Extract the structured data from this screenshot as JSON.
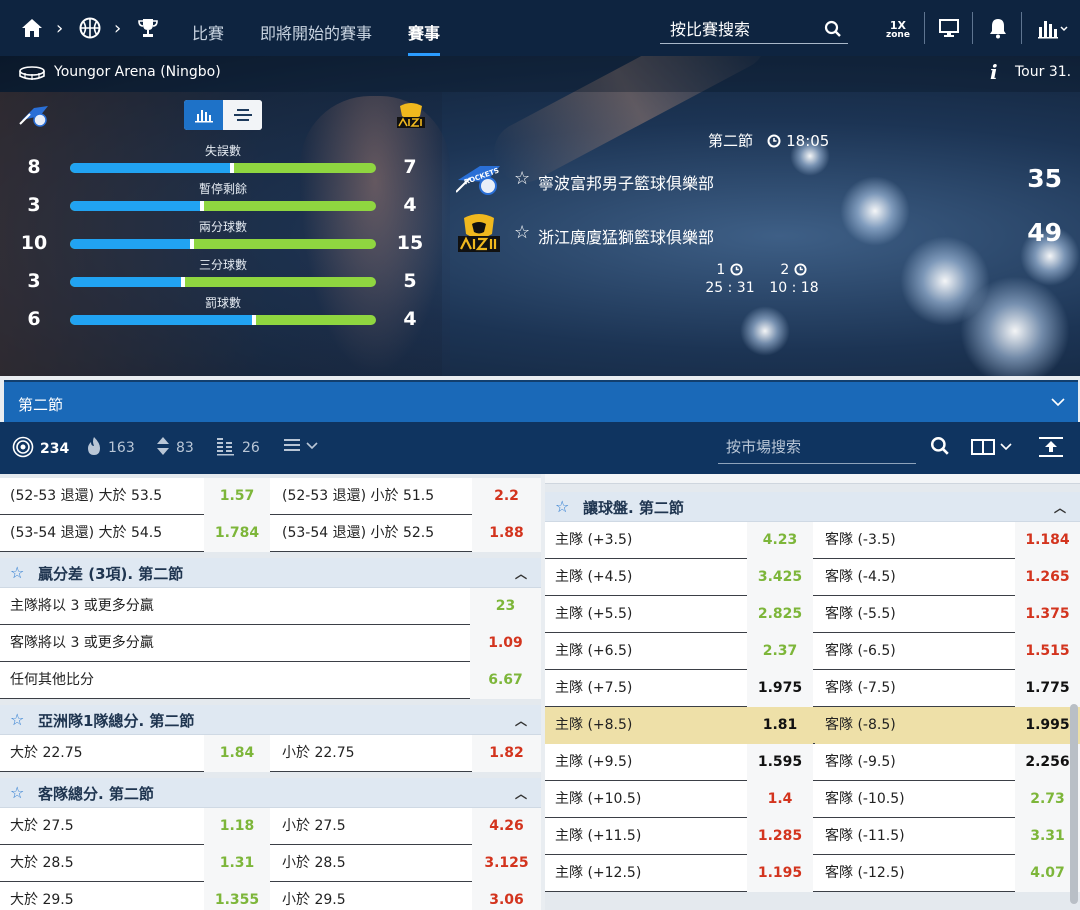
{
  "nav": {
    "items": [
      "比賽",
      "即將開始的賽事",
      "賽事"
    ],
    "active_index": 2,
    "search_placeholder": "按比賽搜索",
    "zone_top": "1X",
    "zone_bottom": "zone"
  },
  "match": {
    "arena": "Youngor Arena (Ningbo)",
    "tour": "Tour 31.",
    "period": "第二節",
    "clock": "18:05",
    "stats": [
      {
        "label": "失誤數",
        "home": "8",
        "away": "7",
        "home_share": 0.53
      },
      {
        "label": "暫停剩餘",
        "home": "3",
        "away": "4",
        "home_share": 0.43
      },
      {
        "label": "兩分球數",
        "home": "10",
        "away": "15",
        "home_share": 0.4
      },
      {
        "label": "三分球數",
        "home": "3",
        "away": "5",
        "home_share": 0.37
      },
      {
        "label": "罰球數",
        "home": "6",
        "away": "4",
        "home_share": 0.6
      }
    ],
    "home": {
      "name": "寧波富邦男子籃球俱樂部",
      "score": "35"
    },
    "away": {
      "name": "浙江廣廈猛獅籃球俱樂部",
      "score": "49"
    },
    "quarters": [
      {
        "label": "1",
        "score": "25 : 31"
      },
      {
        "label": "2",
        "score": "10 : 18"
      }
    ]
  },
  "period_bar": {
    "label": "第二節"
  },
  "filters": {
    "all_count": "234",
    "hot_count": "163",
    "sort_count": "83",
    "stats_count": "26",
    "market_search_placeholder": "按市場搜索"
  },
  "colors": {
    "accent": "#1a69b8",
    "green_odd": "#7db63a",
    "red_odd": "#d3341e",
    "highlight": "#eee0a8"
  },
  "left_column": {
    "top_rows": [
      {
        "a": "(52-53 退還) 大於 53.5",
        "ao": "1.57",
        "ac": "green",
        "b": "(52-53 退還) 小於 51.5",
        "bo": "2.2",
        "bc": "red"
      },
      {
        "a": "(53-54 退還) 大於 54.5",
        "ao": "1.784",
        "ac": "green",
        "b": "(53-54 退還) 小於 52.5",
        "bo": "1.88",
        "bc": "red"
      }
    ],
    "margin_group": {
      "title": "贏分差 (3項). 第二節",
      "rows": [
        {
          "name": "主隊將以 3 或更多分贏",
          "odd": "23",
          "color": "green"
        },
        {
          "name": "客隊將以 3 或更多分贏",
          "odd": "1.09",
          "color": "red"
        },
        {
          "name": "任何其他比分",
          "odd": "6.67",
          "color": "green"
        }
      ]
    },
    "asian_group": {
      "title": "亞洲隊1隊總分. 第二節",
      "rows": [
        {
          "a": "大於 22.75",
          "ao": "1.84",
          "ac": "green",
          "b": "小於 22.75",
          "bo": "1.82",
          "bc": "red"
        }
      ]
    },
    "away_total_group": {
      "title": "客隊總分. 第二節",
      "rows": [
        {
          "a": "大於 27.5",
          "ao": "1.18",
          "ac": "green",
          "b": "小於 27.5",
          "bo": "4.26",
          "bc": "red"
        },
        {
          "a": "大於 28.5",
          "ao": "1.31",
          "ac": "green",
          "b": "小於 28.5",
          "bo": "3.125",
          "bc": "red"
        },
        {
          "a": "大於 29.5",
          "ao": "1.355",
          "ac": "green",
          "b": "小於 29.5",
          "bo": "3.06",
          "bc": "red"
        }
      ]
    }
  },
  "right_column": {
    "handicap_group": {
      "title": "讓球盤. 第二節",
      "rows": [
        {
          "a": "主隊 (+3.5)",
          "ao": "4.23",
          "ac": "green",
          "b": "客隊 (-3.5)",
          "bo": "1.184",
          "bc": "red"
        },
        {
          "a": "主隊 (+4.5)",
          "ao": "3.425",
          "ac": "green",
          "b": "客隊 (-4.5)",
          "bo": "1.265",
          "bc": "red"
        },
        {
          "a": "主隊 (+5.5)",
          "ao": "2.825",
          "ac": "green",
          "b": "客隊 (-5.5)",
          "bo": "1.375",
          "bc": "red"
        },
        {
          "a": "主隊 (+6.5)",
          "ao": "2.37",
          "ac": "green",
          "b": "客隊 (-6.5)",
          "bo": "1.515",
          "bc": "red"
        },
        {
          "a": "主隊 (+7.5)",
          "ao": "1.975",
          "ac": "black",
          "b": "客隊 (-7.5)",
          "bo": "1.775",
          "bc": "black"
        },
        {
          "a": "主隊 (+8.5)",
          "ao": "1.81",
          "ac": "black",
          "b": "客隊 (-8.5)",
          "bo": "1.995",
          "bc": "black",
          "highlight": true
        },
        {
          "a": "主隊 (+9.5)",
          "ao": "1.595",
          "ac": "black",
          "b": "客隊 (-9.5)",
          "bo": "2.256",
          "bc": "black"
        },
        {
          "a": "主隊 (+10.5)",
          "ao": "1.4",
          "ac": "red",
          "b": "客隊 (-10.5)",
          "bo": "2.73",
          "bc": "green"
        },
        {
          "a": "主隊 (+11.5)",
          "ao": "1.285",
          "ac": "red",
          "b": "客隊 (-11.5)",
          "bo": "3.31",
          "bc": "green"
        },
        {
          "a": "主隊 (+12.5)",
          "ao": "1.195",
          "ac": "red",
          "b": "客隊 (-12.5)",
          "bo": "4.07",
          "bc": "green"
        }
      ]
    }
  }
}
